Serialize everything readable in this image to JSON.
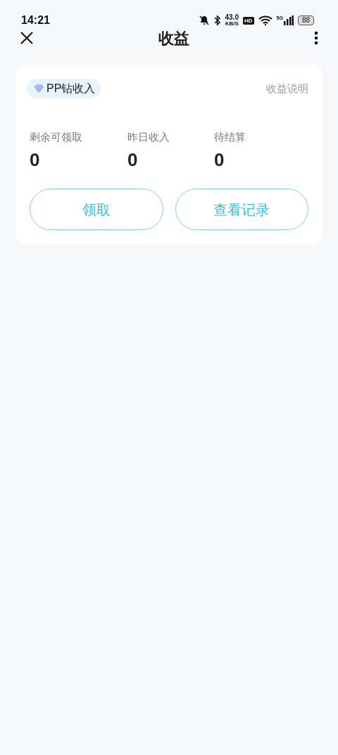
{
  "status_bar": {
    "time": "14:21",
    "speed_value": "43.0",
    "speed_unit": "KB/S",
    "hd": "HD",
    "network": "5G",
    "battery": "88"
  },
  "header": {
    "title": "收益"
  },
  "card": {
    "tag": "PP钻收入",
    "help_link": "收益说明",
    "stats": [
      {
        "label": "剩余可领取",
        "value": "0"
      },
      {
        "label": "昨日收入",
        "value": "0"
      },
      {
        "label": "待结算",
        "value": "0"
      }
    ],
    "buttons": [
      "领取",
      "查看记录"
    ]
  }
}
